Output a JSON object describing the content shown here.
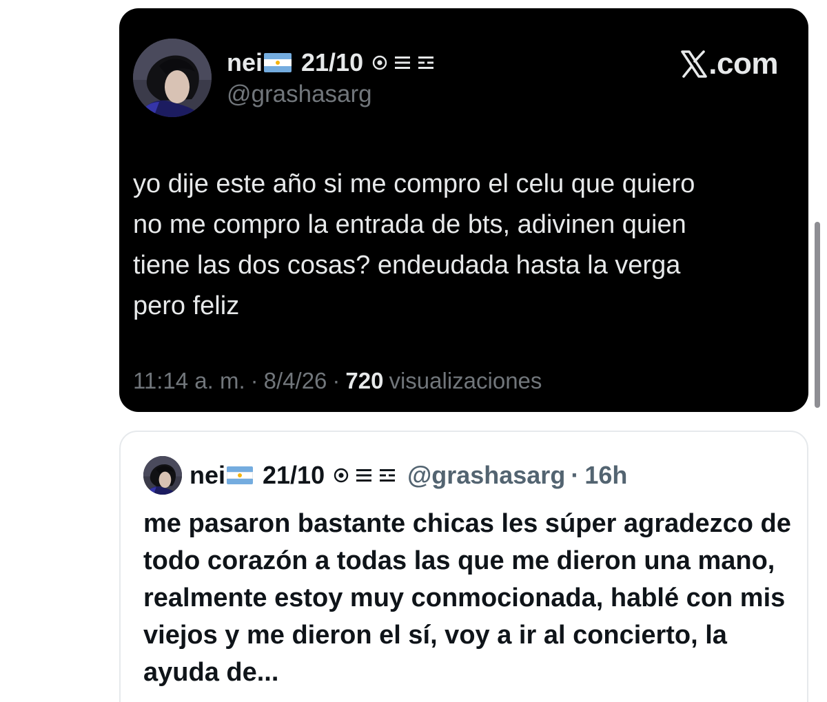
{
  "tweet": {
    "display_name": "nei",
    "name_suffix": "21/10",
    "handle": "@grashasarg",
    "site_label": ".com",
    "text": "yo dije este año si me compro el celu que quiero\nno me compro la entrada de bts, adivinen quien\ntiene las dos cosas? endeudada hasta la verga\npero feliz",
    "time": "11:14 a. m.",
    "separator": "·",
    "date": "8/4/26",
    "views_count": "720",
    "views_label": "visualizaciones",
    "background_color": "#000000",
    "icons": [
      "avatar",
      "argentina-flag-icon",
      "target-icon",
      "menu-lines-icon",
      "list-lines-icon",
      "x-logo-icon"
    ]
  },
  "reply": {
    "display_name": "nei",
    "name_suffix": "21/10",
    "handle": "@grashasarg",
    "separator": "·",
    "time_ago": "16h",
    "text": "me pasaron bastante chicas les súper agradezco de todo corazón a todas las que me dieron una mano, realmente estoy muy conmocionada, hablé con mis viejos y me dieron el sí, voy a ir al concierto, la ayuda de...",
    "icons": [
      "avatar",
      "argentina-flag-icon",
      "target-icon",
      "menu-lines-icon",
      "list-lines-icon"
    ]
  },
  "colors": {
    "flag_blue": "#74acdf",
    "flag_sun": "#f6b40e",
    "muted_dark": "#71767b",
    "muted_light": "#536471"
  }
}
